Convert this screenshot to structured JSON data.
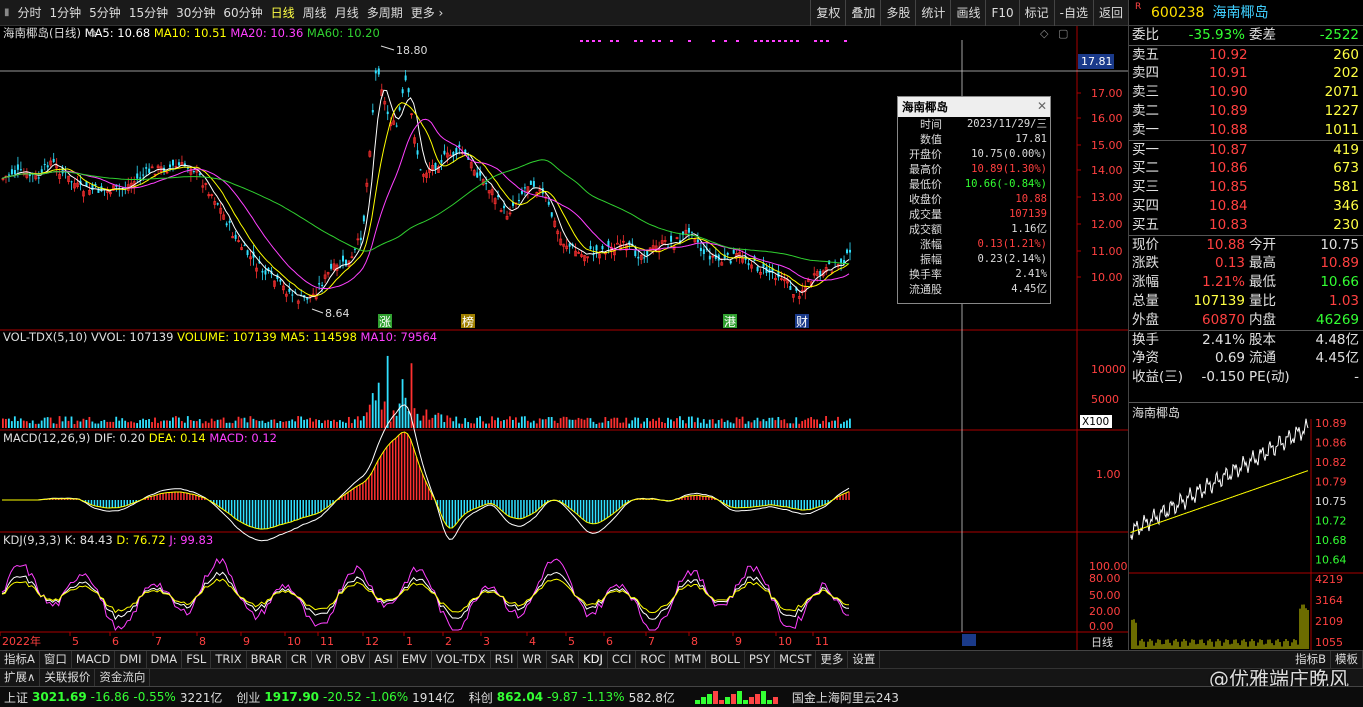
{
  "periods": [
    "分时",
    "1分钟",
    "5分钟",
    "15分钟",
    "30分钟",
    "60分钟",
    "日线",
    "周线",
    "月线",
    "多周期",
    "更多"
  ],
  "active_period": "日线",
  "toolbar_right": [
    "复权",
    "叠加",
    "多股",
    "统计",
    "画线",
    "F10",
    "标记",
    "-自选",
    "返回"
  ],
  "chart_panels": {
    "main": {
      "stock": "海南椰岛(日线)",
      "ma": [
        {
          "t": "MA5: 10.68",
          "c": "#ffffff"
        },
        {
          "t": "MA10: 10.51",
          "c": "#ffff00"
        },
        {
          "t": "MA20: 10.36",
          "c": "#ff40ff"
        },
        {
          "t": "MA60: 10.20",
          "c": "#30d030"
        }
      ],
      "high_label": "18.80",
      "low_label": "8.64",
      "cursor_price": "17.81",
      "y_ticks": [
        "17.00",
        "16.00",
        "15.00",
        "14.00",
        "13.00",
        "12.00",
        "11.00",
        "10.00"
      ],
      "event_tags": [
        "涨",
        "榜",
        "港",
        "财"
      ]
    },
    "vol": {
      "title": "VOL-TDX(5,10)",
      "items": [
        {
          "t": "VVOL: 107139",
          "c": "#e0e0e0"
        },
        {
          "t": "VOLUME: 107139",
          "c": "#ffff00"
        },
        {
          "t": "MA5: 114598",
          "c": "#ffff00"
        },
        {
          "t": "MA10: 79564",
          "c": "#ff40ff"
        }
      ],
      "y_ticks": [
        "10000",
        "5000"
      ],
      "unit": "X100"
    },
    "macd": {
      "title": "MACD(12,26,9)",
      "items": [
        {
          "t": "DIF: 0.20",
          "c": "#e0e0e0"
        },
        {
          "t": "DEA: 0.14",
          "c": "#ffff00"
        },
        {
          "t": "MACD: 0.12",
          "c": "#ff40ff"
        }
      ],
      "y_ticks": [
        "1.00"
      ]
    },
    "kdj": {
      "title": "KDJ(9,3,3)",
      "items": [
        {
          "t": "K: 84.43",
          "c": "#e0e0e0"
        },
        {
          "t": "D: 76.72",
          "c": "#ffff00"
        },
        {
          "t": "J: 99.83",
          "c": "#ff40ff"
        }
      ],
      "y_ticks": [
        "100.00",
        "80.00",
        "50.00",
        "20.00",
        "0.00"
      ]
    },
    "x_labels": [
      "2022年",
      "5",
      "6",
      "7",
      "8",
      "9",
      "10",
      "11",
      "12",
      "1",
      "2",
      "3",
      "4",
      "5",
      "6",
      "7",
      "8",
      "9",
      "10",
      "11"
    ],
    "axis_tag": "日线"
  },
  "tooltip": {
    "title": "海南椰岛",
    "rows": [
      {
        "k": "时间",
        "v": "2023/11/29/三",
        "c": "#dddddd"
      },
      {
        "k": "数值",
        "v": "17.81",
        "c": "#dddddd"
      },
      {
        "k": "开盘价",
        "v": "10.75(0.00%)",
        "c": "#dddddd"
      },
      {
        "k": "最高价",
        "v": "10.89(1.30%)",
        "c": "#ff4040"
      },
      {
        "k": "最低价",
        "v": "10.66(-0.84%)",
        "c": "#33ff33"
      },
      {
        "k": "收盘价",
        "v": "10.88",
        "c": "#ff4040"
      },
      {
        "k": "成交量",
        "v": "107139",
        "c": "#ff4040"
      },
      {
        "k": "成交额",
        "v": "1.16亿",
        "c": "#dddddd"
      },
      {
        "k": "涨幅",
        "v": "0.13(1.21%)",
        "c": "#ff4040"
      },
      {
        "k": "振幅",
        "v": "0.23(2.14%)",
        "c": "#dddddd"
      },
      {
        "k": "换手率",
        "v": "2.41%",
        "c": "#dddddd"
      },
      {
        "k": "流通股",
        "v": "4.45亿",
        "c": "#dddddd"
      }
    ]
  },
  "quote": {
    "code": "600238",
    "name": "海南椰岛",
    "r_mark": "R",
    "webi": {
      "k": "委比",
      "v": "-35.93%",
      "k2": "委差",
      "v2": "-2522"
    },
    "sell": [
      {
        "k": "卖五",
        "p": "10.92",
        "q": "260"
      },
      {
        "k": "卖四",
        "p": "10.91",
        "q": "202"
      },
      {
        "k": "卖三",
        "p": "10.90",
        "q": "2071"
      },
      {
        "k": "卖二",
        "p": "10.89",
        "q": "1227"
      },
      {
        "k": "卖一",
        "p": "10.88",
        "q": "1011"
      }
    ],
    "buy": [
      {
        "k": "买一",
        "p": "10.87",
        "q": "419"
      },
      {
        "k": "买二",
        "p": "10.86",
        "q": "673"
      },
      {
        "k": "买三",
        "p": "10.85",
        "q": "581"
      },
      {
        "k": "买四",
        "p": "10.84",
        "q": "346"
      },
      {
        "k": "买五",
        "p": "10.83",
        "q": "230"
      }
    ],
    "stats": [
      [
        {
          "k": "现价",
          "v": "10.88",
          "c": "red"
        },
        {
          "k": "今开",
          "v": "10.75",
          "c": "wht"
        }
      ],
      [
        {
          "k": "涨跌",
          "v": "0.13",
          "c": "red"
        },
        {
          "k": "最高",
          "v": "10.89",
          "c": "red"
        }
      ],
      [
        {
          "k": "涨幅",
          "v": "1.21%",
          "c": "red"
        },
        {
          "k": "最低",
          "v": "10.66",
          "c": "grn"
        }
      ],
      [
        {
          "k": "总量",
          "v": "107139",
          "c": "yel"
        },
        {
          "k": "量比",
          "v": "1.03",
          "c": "red"
        }
      ],
      [
        {
          "k": "外盘",
          "v": "60870",
          "c": "red"
        },
        {
          "k": "内盘",
          "v": "46269",
          "c": "grn"
        }
      ]
    ],
    "stats2": [
      [
        {
          "k": "换手",
          "v": "2.41%",
          "c": "wht"
        },
        {
          "k": "股本",
          "v": "4.48亿",
          "c": "wht"
        }
      ],
      [
        {
          "k": "净资",
          "v": "0.69",
          "c": "wht"
        },
        {
          "k": "流通",
          "v": "4.45亿",
          "c": "wht"
        }
      ],
      [
        {
          "k": "收益(三)",
          "v": "-0.150",
          "c": "wht"
        },
        {
          "k": "PE(动)",
          "v": "-",
          "c": "wht"
        }
      ]
    ],
    "mini_title": "海南椰岛",
    "mini_y": [
      "10.89",
      "10.86",
      "10.82",
      "10.79",
      "10.75",
      "10.72",
      "10.68",
      "10.64"
    ],
    "mini_vol": [
      "4219",
      "3164",
      "2109",
      "1055"
    ]
  },
  "indicator_tabs": [
    "指标A",
    "窗口",
    "MACD",
    "DMI",
    "DMA",
    "FSL",
    "TRIX",
    "BRAR",
    "CR",
    "VR",
    "OBV",
    "ASI",
    "EMV",
    "VOL-TDX",
    "RSI",
    "WR",
    "SAR",
    "KDJ",
    "CCI",
    "ROC",
    "MTM",
    "BOLL",
    "PSY",
    "MCST",
    "更多",
    "设置"
  ],
  "indicator_right": [
    "指标B",
    "模板"
  ],
  "sub_tabs": [
    "扩展∧",
    "关联报价",
    "资金流向"
  ],
  "status": {
    "sh": {
      "lab": "上证",
      "v": "3021.69",
      "ch": "-16.86",
      "pct": "-0.55%",
      "amt": "3221亿"
    },
    "cy": {
      "lab": "创业",
      "v": "1917.90",
      "ch": "-20.52",
      "pct": "-1.06%",
      "amt": "1914亿"
    },
    "kc": {
      "lab": "科创",
      "v": "862.04",
      "ch": "-9.87",
      "pct": "-1.13%",
      "amt": "582.8亿"
    },
    "server": "国金上海阿里云243"
  },
  "watermark": "@优雅端庄晚风"
}
